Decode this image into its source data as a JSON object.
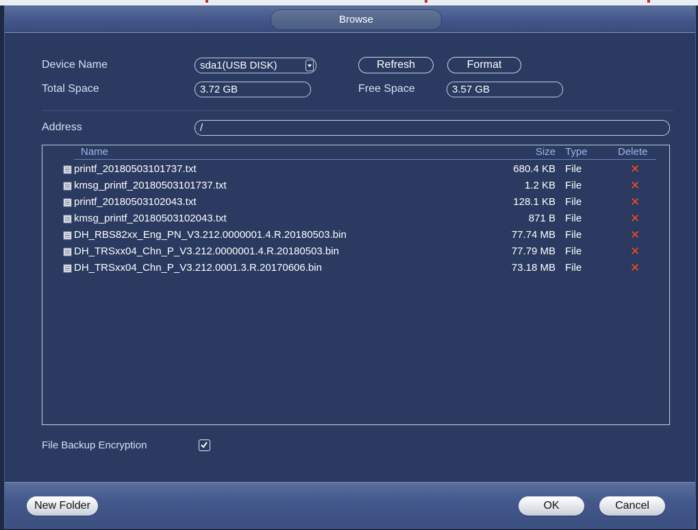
{
  "dialog": {
    "title": "Browse"
  },
  "device": {
    "name_label": "Device Name",
    "name_value": "sda1(USB DISK)",
    "refresh_label": "Refresh",
    "format_label": "Format",
    "total_label": "Total Space",
    "total_value": "3.72 GB",
    "free_label": "Free Space",
    "free_value": "3.57 GB"
  },
  "address": {
    "label": "Address",
    "value": "/"
  },
  "file_table": {
    "columns": {
      "name": "Name",
      "size": "Size",
      "type": "Type",
      "delete": "Delete"
    },
    "rows": [
      {
        "name": "printf_20180503101737.txt",
        "size": "680.4 KB",
        "type": "File"
      },
      {
        "name": "kmsg_printf_20180503101737.txt",
        "size": "1.2 KB",
        "type": "File"
      },
      {
        "name": "printf_20180503102043.txt",
        "size": "128.1 KB",
        "type": "File"
      },
      {
        "name": "kmsg_printf_20180503102043.txt",
        "size": "871 B",
        "type": "File"
      },
      {
        "name": "DH_RBS82xx_Eng_PN_V3.212.0000001.4.R.20180503.bin",
        "size": "77.74 MB",
        "type": "File"
      },
      {
        "name": "DH_TRSxx04_Chn_P_V3.212.0000001.4.R.20180503.bin",
        "size": "77.79 MB",
        "type": "File"
      },
      {
        "name": "DH_TRSxx04_Chn_P_V3.212.0001.3.R.20170606.bin",
        "size": "73.18 MB",
        "type": "File"
      }
    ],
    "delete_glyph": "✕"
  },
  "encryption": {
    "label": "File Backup Encryption",
    "checked": true
  },
  "footer": {
    "new_folder_label": "New Folder",
    "ok_label": "OK",
    "cancel_label": "Cancel"
  },
  "colors": {
    "background": "#2a3a60",
    "label_text": "#d6e0f5",
    "header_text": "#9fb6e6",
    "delete_icon": "#ff4a1a"
  },
  "icons": {
    "file": "file-icon",
    "delete": "delete-icon",
    "dropdown": "chevron-down-icon",
    "checkbox": "checkmark-icon"
  }
}
